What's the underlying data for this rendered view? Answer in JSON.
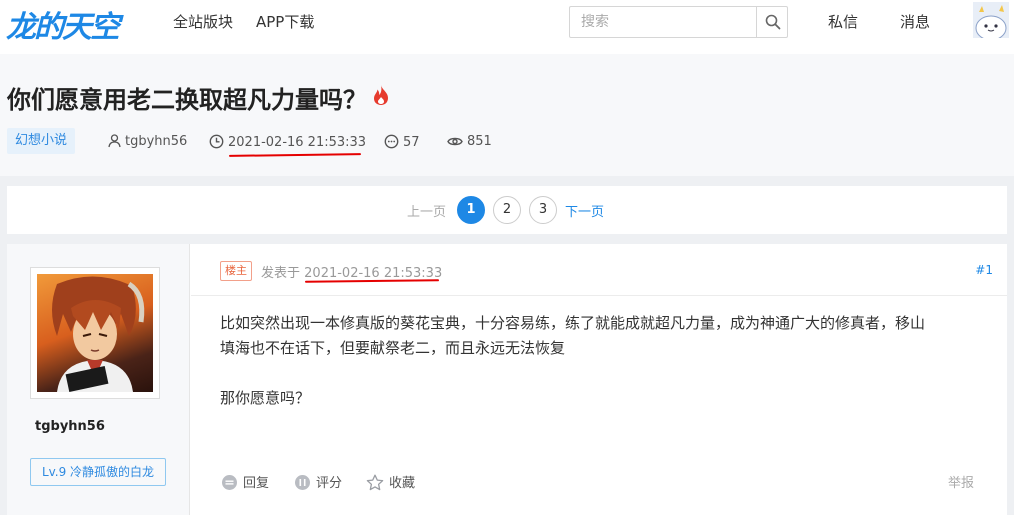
{
  "header": {
    "logo": "龙的天空",
    "nav": [
      "全站版块",
      "APP下载"
    ],
    "search_placeholder": "搜索",
    "links": [
      "私信",
      "消息"
    ]
  },
  "thread": {
    "title": "你们愿意用老二换取超凡力量吗？",
    "category": "幻想小说",
    "author": "tgbyhn56",
    "datetime": "2021-02-16 21:53:33",
    "replies": "57",
    "views": "851"
  },
  "pagination": {
    "prev": "上一页",
    "pages": [
      "1",
      "2",
      "3"
    ],
    "current": "1",
    "next": "下一页"
  },
  "post": {
    "username": "tgbyhn56",
    "level": "Lv.9 冷静孤傲的白龙",
    "role_badge": "楼主",
    "posted_prefix": "发表于",
    "posted_time": "2021-02-16 21:53:33",
    "floor": "#1",
    "lines": [
      "比如突然出现一本修真版的葵花宝典，十分容易练，练了就能成就超凡力量，成为神通广大的修真者，移山",
      "填海也不在话下，但要献祭老二，而且永远无法恢复",
      "那你愿意吗？"
    ],
    "actions": {
      "reply": "回复",
      "rate": "评分",
      "favorite": "收藏",
      "report": "举报"
    }
  },
  "colors": {
    "brand": "#1e88e5",
    "annotation": "#e50000"
  }
}
